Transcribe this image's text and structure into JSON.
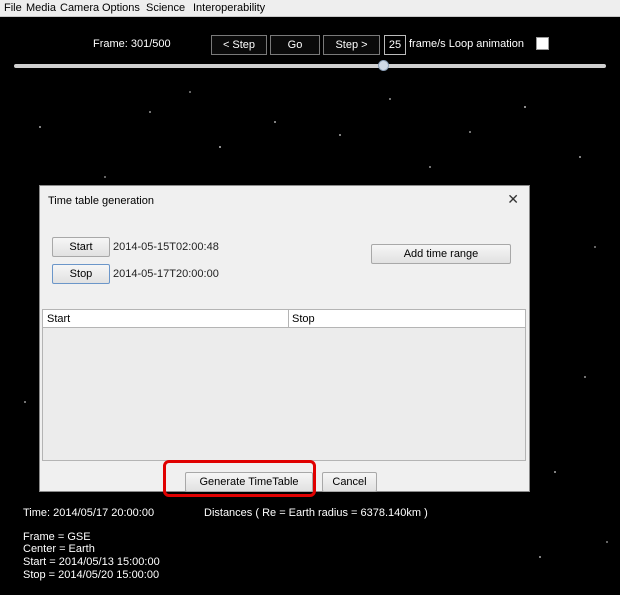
{
  "menubar": [
    "File",
    "Media",
    "Camera",
    "Options",
    "Science",
    "Interoperability"
  ],
  "controls": {
    "frame_label": "Frame: 301/500",
    "step_back": "< Step",
    "go": "Go",
    "step_forward": "Step >",
    "fps_value": "25",
    "fps_label": "frame/s  Loop animation",
    "loop_checked": false,
    "frame_progress": 0.6
  },
  "dialog": {
    "title": "Time table generation",
    "close": "✕",
    "start_button": "Start",
    "start_value": "2014-05-15T02:00:48",
    "stop_button": "Stop",
    "stop_value": "2014-05-17T20:00:00",
    "add_range": "Add time range",
    "columns": [
      "Start",
      "Stop"
    ],
    "generate": "Generate TimeTable",
    "cancel": "Cancel"
  },
  "info": {
    "time": "Time: 2014/05/17 20:00:00",
    "distances": "Distances ( Re = Earth radius = 6378.140km )",
    "frame": "Frame = GSE",
    "center": "Center = Earth",
    "start": "Start = 2014/05/13 15:00:00",
    "stop": "Stop = 2014/05/20 15:00:00"
  },
  "colors": {
    "highlight": "#e00000",
    "background": "#000000"
  }
}
